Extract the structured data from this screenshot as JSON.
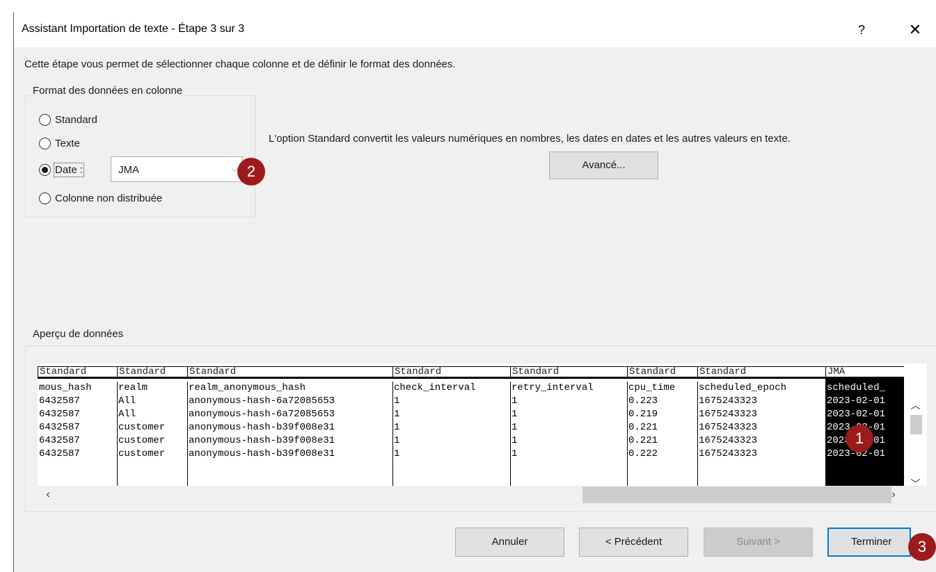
{
  "dialog": {
    "title": "Assistant Importation de texte - Étape 3 sur 3",
    "help_label": "?",
    "close_label": "✕"
  },
  "intro_text": "Cette étape vous permet de sélectionner chaque colonne et de définir le format des données.",
  "format_group": {
    "legend": "Format des données en colonne",
    "options": [
      {
        "label": "Standard",
        "checked": false
      },
      {
        "label": "Texte",
        "checked": false
      },
      {
        "label": "Date :",
        "checked": true
      },
      {
        "label": "Colonne non distribuée",
        "checked": false
      }
    ],
    "date_format": {
      "value": "JMA"
    }
  },
  "description": "L'option Standard convertit les valeurs numériques en nombres, les dates en dates et les autres valeurs en texte.",
  "advanced_button": "Avancé...",
  "preview": {
    "legend": "Aperçu de données",
    "columns": [
      {
        "format": "Standard",
        "header": "mous_hash",
        "cells": [
          "6432587",
          "6432587",
          "6432587",
          "6432587",
          "6432587"
        ]
      },
      {
        "format": "Standard",
        "header": "realm",
        "cells": [
          "All",
          "All",
          "customer",
          "customer",
          "customer"
        ]
      },
      {
        "format": "Standard",
        "header": "realm_anonymous_hash",
        "cells": [
          "anonymous-hash-6a72085653",
          "anonymous-hash-6a72085653",
          "anonymous-hash-b39f008e31",
          "anonymous-hash-b39f008e31",
          "anonymous-hash-b39f008e31"
        ]
      },
      {
        "format": "Standard",
        "header": "check_interval",
        "cells": [
          "1",
          "1",
          "1",
          "1",
          "1"
        ]
      },
      {
        "format": "Standard",
        "header": "retry_interval",
        "cells": [
          "1",
          "1",
          "1",
          "1",
          "1"
        ]
      },
      {
        "format": "Standard",
        "header": "cpu_time",
        "cells": [
          "0.223",
          "0.219",
          "0.221",
          "0.221",
          "0.222"
        ]
      },
      {
        "format": "Standard",
        "header": "scheduled_epoch",
        "cells": [
          "1675243323",
          "1675243323",
          "1675243323",
          "1675243323",
          "1675243323"
        ]
      },
      {
        "format": "JMA",
        "header": "scheduled_",
        "cells": [
          "2023-02-01",
          "2023-02-01",
          "2023-02-01",
          "2023-02-01",
          "2023-02-01"
        ],
        "selected": true
      }
    ]
  },
  "callouts": [
    "1",
    "2",
    "3"
  ],
  "buttons": {
    "cancel": "Annuler",
    "previous": "< Précédent",
    "next": "Suivant >",
    "finish": "Terminer"
  },
  "colors": {
    "callout": "#9e1b1b",
    "dialog_bg": "#f0f0f0",
    "selected_column": "#000000",
    "default_button_border": "#0078d7"
  }
}
